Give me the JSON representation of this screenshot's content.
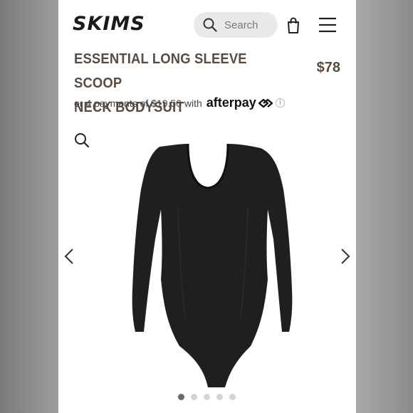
{
  "header": {
    "logo_text": "SKIMS",
    "search_placeholder": "Search",
    "icons": {
      "search": "search-icon",
      "bag": "shopping-bag-icon",
      "menu": "hamburger-menu-icon"
    }
  },
  "product": {
    "title_line1": "ESSENTIAL LONG SLEEVE SCOOP",
    "title_line2": "NECK BODYSUIT",
    "price": "$78",
    "installments_text": "or 4 payments of $19.50 with",
    "afterpay_brand": "afterpay",
    "info_icon": "i",
    "image_alt": "black long sleeve scoop neck bodysuit"
  },
  "gallery": {
    "icons": {
      "zoom": "zoom-icon",
      "prev": "chevron-left-icon",
      "next": "chevron-right-icon"
    },
    "dots_total": 5,
    "active_dot": 1
  },
  "colors": {
    "title": "#5a4b41",
    "product": "#1f1f1f",
    "dot_active": "#6a6a6a",
    "dot_inactive": "#d4d4d4"
  }
}
